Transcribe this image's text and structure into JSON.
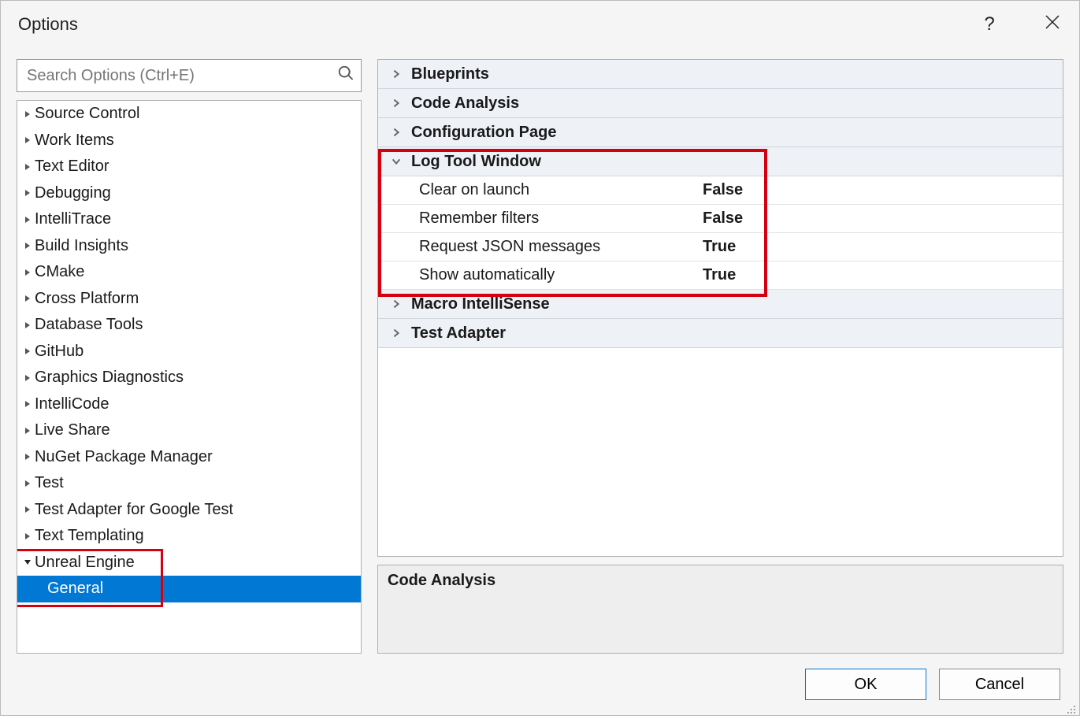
{
  "title": "Options",
  "search": {
    "placeholder": "Search Options (Ctrl+E)"
  },
  "tree": {
    "items": [
      {
        "label": "Source Control",
        "expanded": false
      },
      {
        "label": "Work Items",
        "expanded": false
      },
      {
        "label": "Text Editor",
        "expanded": false
      },
      {
        "label": "Debugging",
        "expanded": false
      },
      {
        "label": "IntelliTrace",
        "expanded": false
      },
      {
        "label": "Build Insights",
        "expanded": false
      },
      {
        "label": "CMake",
        "expanded": false
      },
      {
        "label": "Cross Platform",
        "expanded": false
      },
      {
        "label": "Database Tools",
        "expanded": false
      },
      {
        "label": "GitHub",
        "expanded": false
      },
      {
        "label": "Graphics Diagnostics",
        "expanded": false
      },
      {
        "label": "IntelliCode",
        "expanded": false
      },
      {
        "label": "Live Share",
        "expanded": false
      },
      {
        "label": "NuGet Package Manager",
        "expanded": false
      },
      {
        "label": "Test",
        "expanded": false
      },
      {
        "label": "Test Adapter for Google Test",
        "expanded": false
      },
      {
        "label": "Text Templating",
        "expanded": false
      },
      {
        "label": "Unreal Engine",
        "expanded": true,
        "children": [
          {
            "label": "General",
            "selected": true
          }
        ]
      }
    ]
  },
  "categories": [
    {
      "label": "Blueprints",
      "expanded": false,
      "props": []
    },
    {
      "label": "Code Analysis",
      "expanded": false,
      "props": []
    },
    {
      "label": "Configuration Page",
      "expanded": false,
      "props": []
    },
    {
      "label": "Log Tool Window",
      "expanded": true,
      "props": [
        {
          "label": "Clear on launch",
          "value": "False"
        },
        {
          "label": "Remember filters",
          "value": "False"
        },
        {
          "label": "Request JSON messages",
          "value": "True"
        },
        {
          "label": "Show automatically",
          "value": "True"
        }
      ]
    },
    {
      "label": "Macro IntelliSense",
      "expanded": false,
      "props": []
    },
    {
      "label": "Test Adapter",
      "expanded": false,
      "props": []
    }
  ],
  "description": {
    "title": "Code Analysis"
  },
  "buttons": {
    "ok": "OK",
    "cancel": "Cancel"
  }
}
